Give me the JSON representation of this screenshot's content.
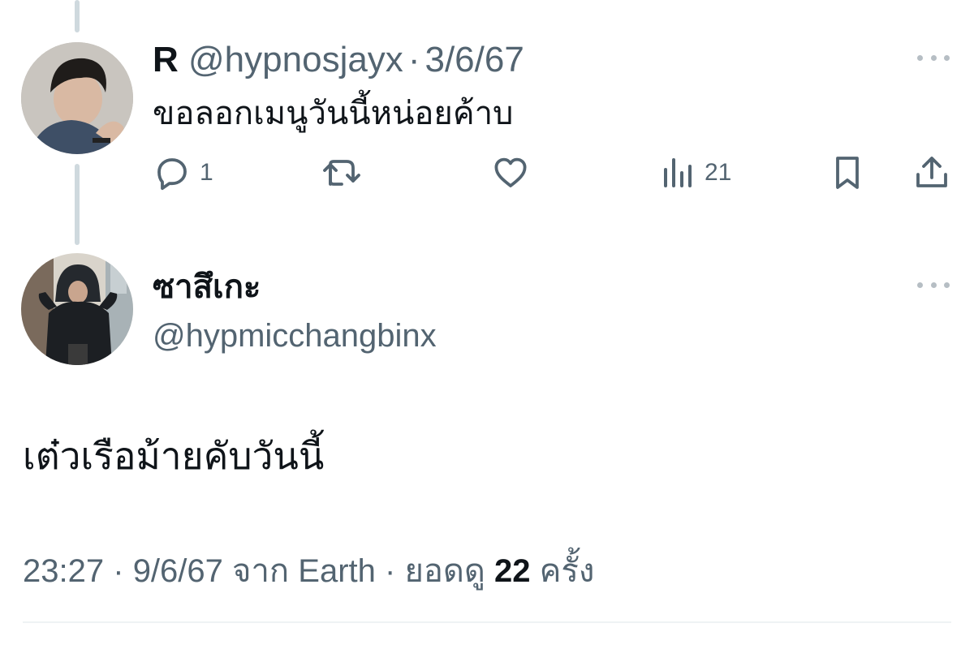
{
  "reply": {
    "display_name": "R",
    "handle": "@hypnosjayx",
    "separator": "·",
    "date": "3/6/67",
    "text": "ขอลอกเมนูวันนี้หน่อยค้าบ",
    "actions": {
      "reply_icon": "reply-icon",
      "reply_count": "1",
      "retweet_icon": "retweet-icon",
      "like_icon": "heart-icon",
      "views_icon": "views-chart-icon",
      "views_count": "21",
      "bookmark_icon": "bookmark-icon",
      "share_icon": "share-icon"
    }
  },
  "main_post": {
    "display_name": "ซาสึเกะ",
    "handle": "@hypmicchangbinx",
    "text": "เต๋วเรือม้ายคับวันนี้",
    "meta": {
      "time": "23:27",
      "separator": "·",
      "date": "9/6/67",
      "source_prefix": "จาก",
      "source": "Earth",
      "views_prefix": "ยอดดู",
      "views_count": "22",
      "views_suffix": "ครั้ง"
    }
  },
  "colors": {
    "text_primary": "#0f1419",
    "text_secondary": "#536471",
    "thread_line": "#cfd9de",
    "divider": "#eff3f4"
  }
}
